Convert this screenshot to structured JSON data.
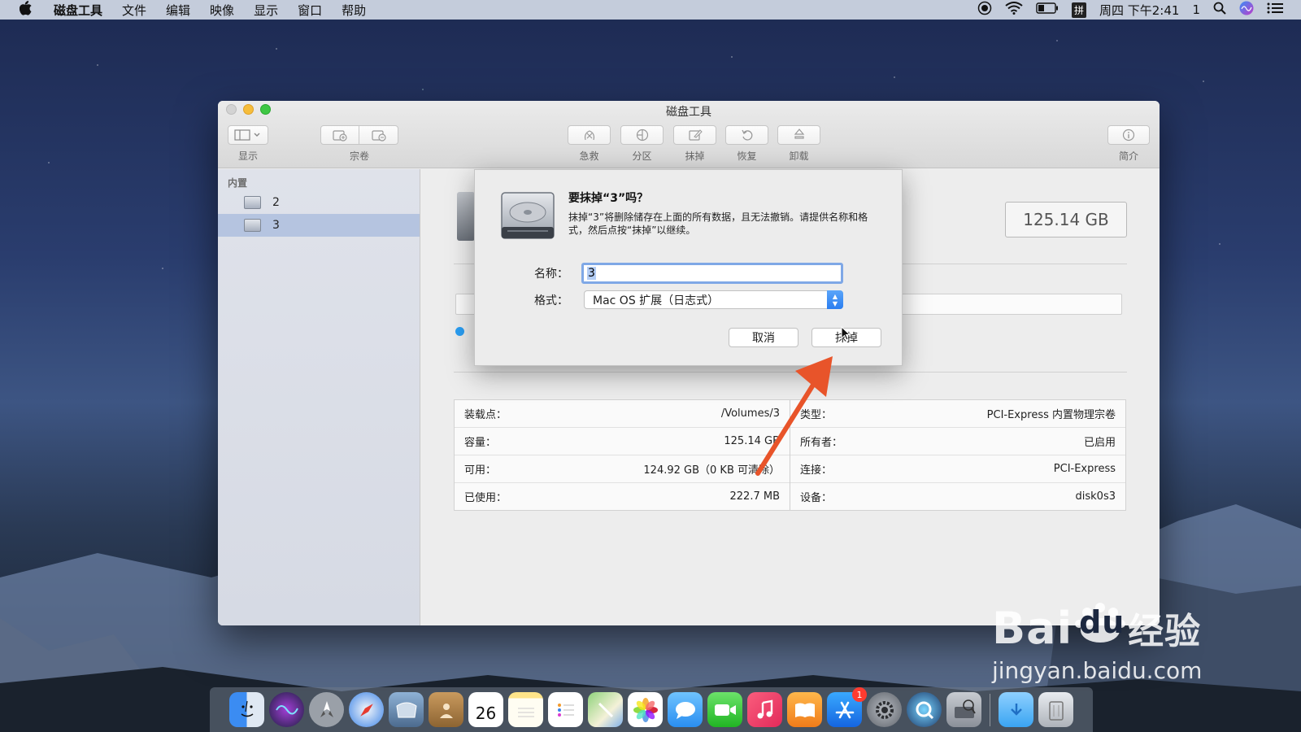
{
  "menubar": {
    "app_name": "磁盘工具",
    "items": [
      "文件",
      "编辑",
      "映像",
      "显示",
      "窗口",
      "帮助"
    ],
    "input_method": "拼",
    "datetime": "周四 下午2:41",
    "notification_count": "1"
  },
  "window": {
    "title": "磁盘工具",
    "toolbar": {
      "view_label": "显示",
      "volume_label": "宗卷",
      "firstaid_label": "急救",
      "partition_label": "分区",
      "erase_label": "抹掉",
      "restore_label": "恢复",
      "unmount_label": "卸载",
      "info_label": "简介"
    },
    "sidebar": {
      "section": "内置",
      "items": [
        {
          "label": "2",
          "selected": false
        },
        {
          "label": "3",
          "selected": true
        }
      ]
    },
    "capacity": "125.14 GB",
    "info": {
      "left": [
        {
          "key": "装载点：",
          "value": "/Volumes/3"
        },
        {
          "key": "容量：",
          "value": "125.14 GB"
        },
        {
          "key": "可用：",
          "value": "124.92 GB（0 KB 可清除）"
        },
        {
          "key": "已使用：",
          "value": "222.7 MB"
        }
      ],
      "right": [
        {
          "key": "类型：",
          "value": "PCI-Express 内置物理宗卷"
        },
        {
          "key": "所有者：",
          "value": "已启用"
        },
        {
          "key": "连接：",
          "value": "PCI-Express"
        },
        {
          "key": "设备：",
          "value": "disk0s3"
        }
      ]
    }
  },
  "dialog": {
    "title": "要抹掉“3”吗？",
    "description": "抹掉“3”将删除储存在上面的所有数据，且无法撤销。请提供名称和格式，然后点按“抹掉”以继续。",
    "name_label": "名称：",
    "name_value": "3",
    "format_label": "格式：",
    "format_value": "Mac OS 扩展（日志式）",
    "cancel_label": "取消",
    "erase_label": "抹掉"
  },
  "dock": {
    "calendar_day": "26",
    "appstore_badge": "1"
  },
  "watermark": {
    "main": "Bai",
    "paw_text": "du",
    "cn": "经验",
    "url": "jingyan.baidu.com"
  },
  "colors": {
    "accent": "#2b7ef0",
    "selection": "#b5c4e0",
    "annotation_arrow": "#e8542a"
  }
}
